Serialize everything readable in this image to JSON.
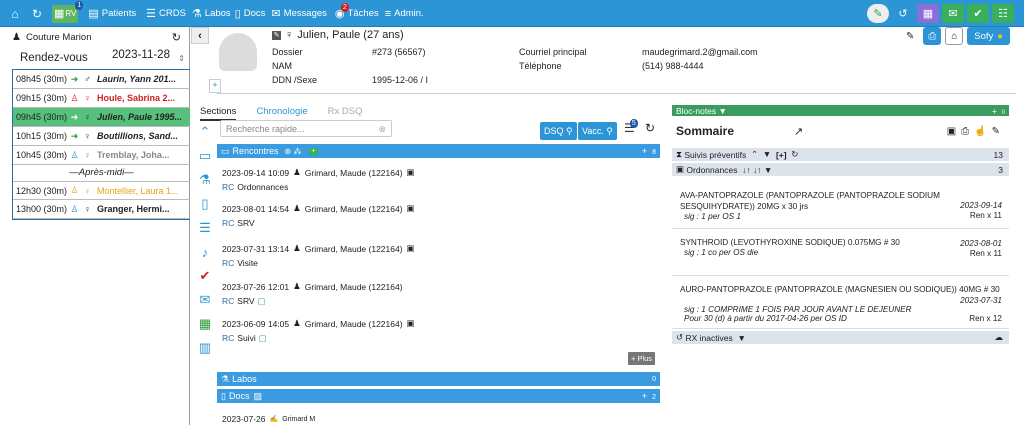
{
  "nav": {
    "rv_label": "RV",
    "rv_badge": "1",
    "patients": "Patients",
    "crds": "CRDS",
    "labos": "Labos",
    "docs": "Docs",
    "messages": "Messages",
    "taches": "Tâches",
    "taches_badge": "2",
    "admin": "Admin."
  },
  "left": {
    "user": "Couture Marion",
    "rdv_label": "Rendez-vous",
    "date": "2023-11-28",
    "appointments": [
      {
        "time": "08h45 (30m)",
        "name": "Laurin, Yann 201...",
        "color": "#000000"
      },
      {
        "time": "09h15 (30m)",
        "name": "Houle, Sabrina 2...",
        "color": "#d01f1f"
      },
      {
        "time": "09h45 (30m)",
        "name": "Julien, Paule 1995...",
        "color": "#000000"
      },
      {
        "time": "10h15 (30m)",
        "name": "Boutillions, Sand...",
        "color": "#000000"
      },
      {
        "time": "10h45 (30m)",
        "name": "Tremblay, Joha...",
        "color": "#888888"
      }
    ],
    "separator": "—Après-midi—",
    "appointments_pm": [
      {
        "time": "12h30 (30m)",
        "name": "Montellier, Laura 1...",
        "color": "#e8a317"
      },
      {
        "time": "13h00 (30m)",
        "name": "Granger, Hermi...",
        "color": "#000000"
      }
    ]
  },
  "patient": {
    "name": "Julien, Paule (27 ans)",
    "dossier_label": "Dossier",
    "dossier": "#273 (56567)",
    "nam_label": "NAM",
    "ddn_label": "DDN /Sexe",
    "ddn": "1995-12-06 / I",
    "courriel_label": "Courriel principal",
    "courriel": "maudegrimard.2@gmail.com",
    "tel_label": "Téléphone",
    "tel": "(514) 988-4444",
    "sofy": "Sofy"
  },
  "tabs": [
    "Sections",
    "Chronologie",
    "Rx DSQ"
  ],
  "search_placeholder": "Recherche rapide...",
  "dsq_label": "DSQ",
  "vacc_label": "Vacc.",
  "list_badge": "5",
  "rencontres": {
    "title": "Rencontres",
    "count": "8",
    "items": [
      {
        "date": "2023-09-14 10:09",
        "author": "Grimard, Maude (122164)",
        "type": "Ordonnances"
      },
      {
        "date": "2023-08-01 14:54",
        "author": "Grimard, Maude (122164)",
        "type": "SRV"
      },
      {
        "date": "2023-07-31 13:14",
        "author": "Grimard, Maude (122164)",
        "type": "Visite"
      },
      {
        "date": "2023-07-26 12:01",
        "author": "Grimard, Maude (122164)",
        "type": "SRV"
      },
      {
        "date": "2023-06-09 14:05",
        "author": "Grimard, Maude (122164)",
        "type": "Suivi"
      }
    ],
    "rc": "RC",
    "plus": "Plus"
  },
  "labos": {
    "title": "Labos",
    "count": "0"
  },
  "docs": {
    "title": "Docs",
    "count": "2",
    "first_date": "2023-07-26",
    "first_author": "Grimard M"
  },
  "bloc_notes": {
    "title": "Bloc-notes",
    "count": "0"
  },
  "sommaire": {
    "title": "Sommaire",
    "suivis": "Suivis préventifs",
    "suivis_extra": "[+]",
    "suivis_count": "13",
    "ordonnances": "Ordonnances",
    "ordonnances_count": "3",
    "meds": [
      {
        "name": "AVA-PANTOPRAZOLE (PANTOPRAZOLE (PANTOPRAZOLE SODIUM SESQUIHYDRATE)) 20MG x 30 jrs",
        "sig": "sig : 1 per OS 1",
        "date": "2023-09-14",
        "ren": "Ren x 11"
      },
      {
        "name": "SYNTHROID (LEVOTHYROXINE SODIQUE) 0.075MG # 30",
        "sig": "sig : 1 co per OS die",
        "date": "2023-08-01",
        "ren": "Ren x 11"
      },
      {
        "name": "AURO-PANTOPRAZOLE (PANTOPRAZOLE (MAGNESIEN OU SODIQUE)) 40MG # 30",
        "sig": "sig : 1 COMPRIME 1 FOIS PAR JOUR AVANT LE DEJEUNER Pour 30 (d) à partir du 2017-04-26 per OS ID",
        "date": "2023-07-31",
        "ren": "Ren x 12"
      }
    ],
    "rx_inactives": "RX inactives"
  }
}
